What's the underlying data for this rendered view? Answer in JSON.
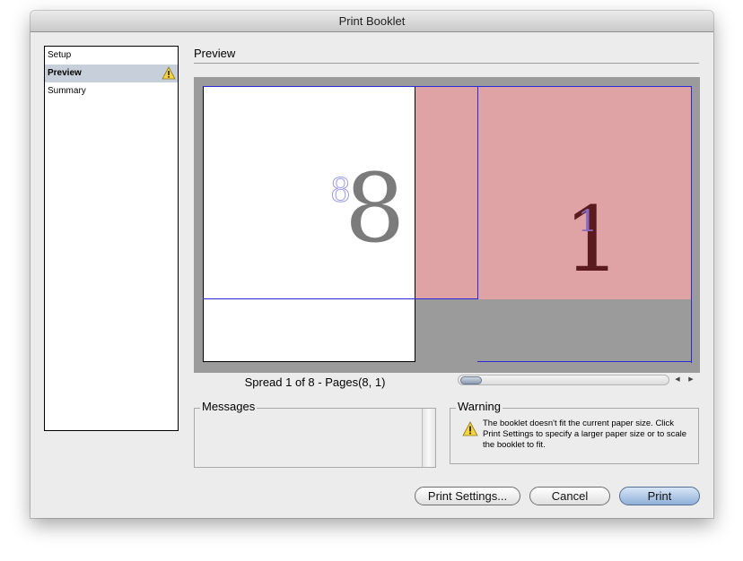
{
  "window": {
    "title": "Print Booklet"
  },
  "nav": {
    "items": [
      {
        "label": "Setup"
      },
      {
        "label": "Preview"
      },
      {
        "label": "Summary"
      }
    ],
    "selected": "Preview"
  },
  "preview": {
    "section_title": "Preview",
    "left_page_number": "8",
    "right_page_number": "1",
    "spread_label": "Spread 1 of 8 - Pages(8, 1)"
  },
  "messages": {
    "title": "Messages"
  },
  "warning": {
    "title": "Warning",
    "text": "The booklet doesn't fit the current paper size. Click Print Settings to specify a larger paper size or to scale the booklet to fit."
  },
  "buttons": {
    "print_settings": "Print Settings...",
    "cancel": "Cancel",
    "print": "Print"
  },
  "icons": {
    "warning": "warning-triangle-icon",
    "scroll_left": "◀",
    "scroll_right": "▶"
  },
  "colors": {
    "selected_row": "#c7cfda",
    "overflow_page": "#dfa3a5",
    "preview_bg": "#9b9b9b",
    "guide": "#2a2ad6"
  }
}
